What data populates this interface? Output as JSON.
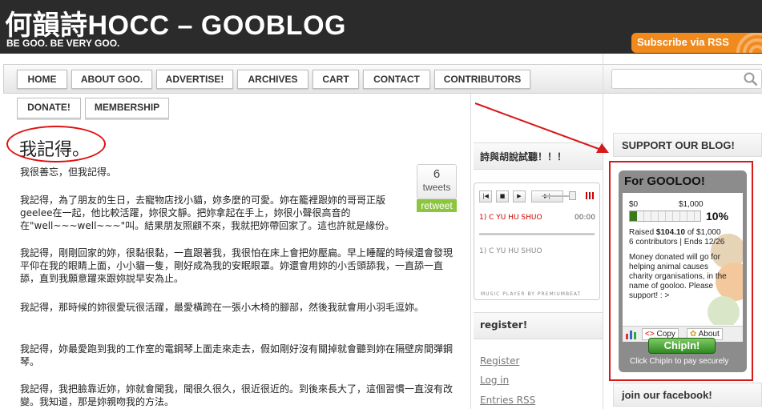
{
  "site": {
    "title": "何韻詩HOCC – GOOBLOG",
    "tagline": "BE GOO. BE VERY GOO.",
    "rss_label": "Subscribe via RSS"
  },
  "nav": {
    "items": [
      "HOME",
      "ABOUT GOO.",
      "ADVERTISE!",
      "ARCHIVES",
      "CART",
      "CONTACT",
      "CONTRIBUTORS"
    ],
    "items_row2": [
      "DONATE!",
      "MEMBERSHIP"
    ]
  },
  "search": {
    "placeholder": ""
  },
  "post": {
    "title": "我記得。",
    "paragraphs": [
      "我很善忘，但我記得。",
      "我記得，為了朋友的生日，去寵物店找小貓，妳多麼的可愛。妳在籠裡跟妳的哥哥正版geelee在一起，他比較活躍，妳很文靜。把妳拿起在手上，妳很小聲很高音的在\"well~~~well~~~\"叫。結果朋友照顧不來，我就把妳帶回家了。這也許就是緣份。",
      "我記得，剛剛回家的妳，很黏很黏，一直跟著我，我很怕在床上會把妳壓扁。早上睡醒的時候還會發現平仰在我的眼睛上面，小小貓一隻，剛好成為我的安眠眼罩。妳還會用妳的小舌頭舔我，一直舔一直舔，直到我願意躍來跟妳說早安為止。",
      "我記得，那時候的妳很愛玩很活躍，最愛橫跨在一張小木椅的腳部，然後我就會用小羽毛逗妳。",
      "我記得，妳最愛跑到我的工作室的電鋼琴上面走來走去，假如剛好沒有關掉就會聽到妳在隔壁房間彈鋼琴。",
      "我記得，我把臉靠近妳，妳就會聞我，聞很久很久，很近很近的。到後來長大了，這個習慣一直沒有改變。我知道，那是妳親吻我的方法。"
    ]
  },
  "tweet": {
    "count": "6",
    "label": "tweets",
    "retweet": "retweet"
  },
  "middle": {
    "poetry_heading": "詩與胡說試聽！！！",
    "player": {
      "tracks": [
        "1) C YU HU SHUO",
        "1) C YU HU SHUO"
      ],
      "time": "00:00",
      "credit": "MUSIC PLAYER BY PREMIUMBEAT"
    },
    "register_heading": "register!",
    "links": [
      "Register",
      "Log in",
      "Entries RSS"
    ]
  },
  "right": {
    "support_heading": "SUPPORT OUR BLOG!",
    "facebook_heading": "join our facebook!"
  },
  "chipin": {
    "title": "For GOOLOO!",
    "min_label": "$0",
    "max_label": "$1,000",
    "percent": "10%",
    "progress_fraction": 0.1,
    "raised_prefix": "Raised ",
    "raised_amount": "$104.10",
    "raised_suffix": " of $1,000",
    "stats": "6 contributors | Ends 12/26",
    "description": "Money donated will go for helping animal causes charity organisations, in the name of gooloo. Please support! : >",
    "copy_label": "Copy",
    "about_label": "About",
    "button_label": "ChipIn!",
    "footer": "Click ChipIn to pay securely"
  },
  "colors": {
    "header_bg": "#2b2b2b",
    "rss_orange": "#f08a1c",
    "annotation_red": "#d61a1a",
    "retweet_green": "#8cc63f",
    "chipin_green": "#3d9b2e"
  }
}
